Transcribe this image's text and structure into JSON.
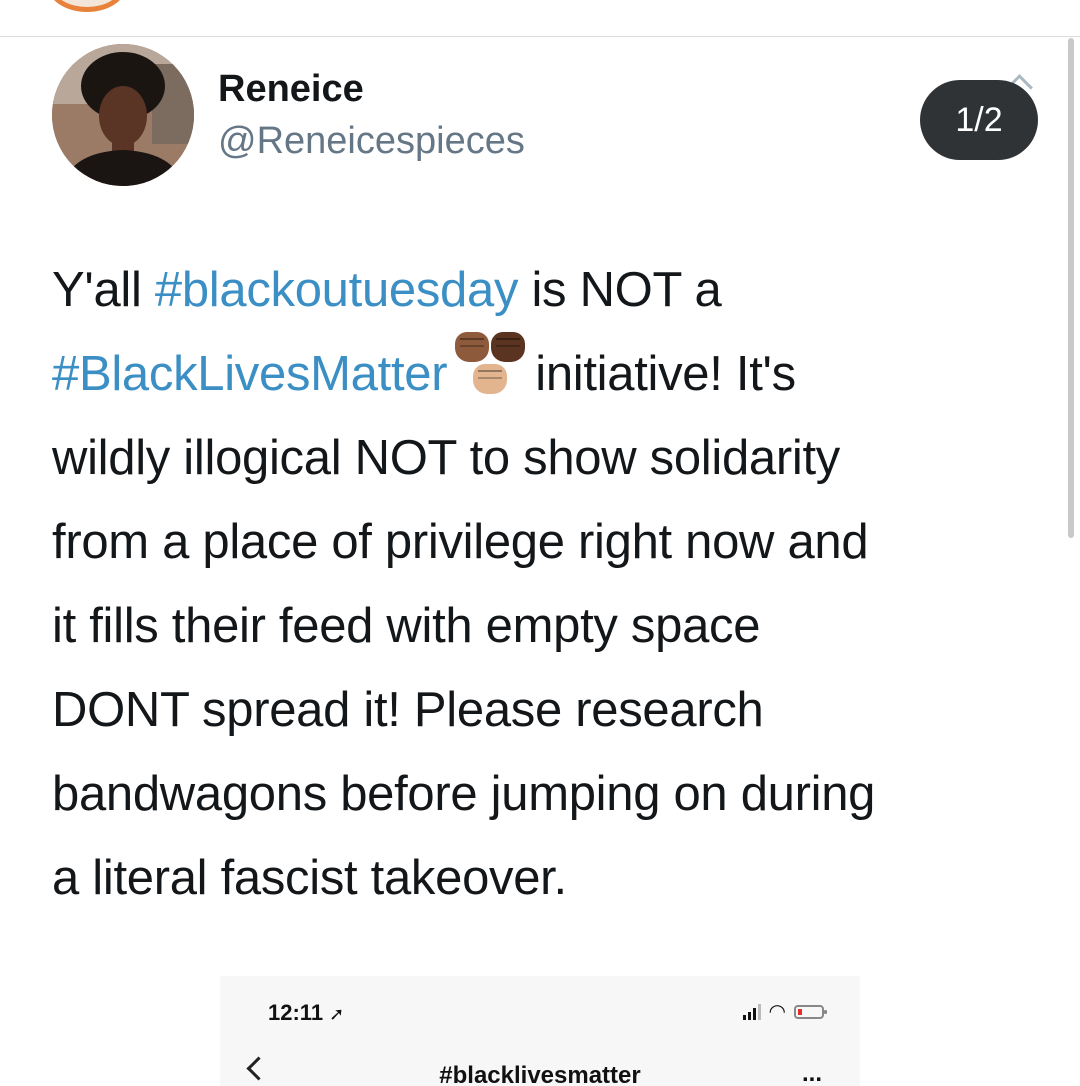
{
  "tweet": {
    "page_indicator": "1/2",
    "author": {
      "name": "Reneice",
      "handle": "@Reneicespieces"
    },
    "text_lines": [
      [
        "Y'all ",
        "#blackoutuesday",
        " is NOT a"
      ],
      [
        "#BlackLivesMatter",
        "initiative! It's"
      ],
      "wildly illogical NOT to show solidarity",
      "from a place of privilege right now and",
      "it fills their feed with empty space",
      "DONT spread it! Please research",
      "bandwagons before jumping on during",
      "a literal fascist takeover."
    ],
    "emoji": "raised-fists-emoji"
  },
  "embedded_screenshot": {
    "time": "12:11",
    "nav_title": "#blacklivesmatter",
    "more": "..."
  },
  "colors": {
    "hashtag": "#3b8fc4",
    "badge_bg": "#2f3336",
    "handle": "#657786"
  }
}
